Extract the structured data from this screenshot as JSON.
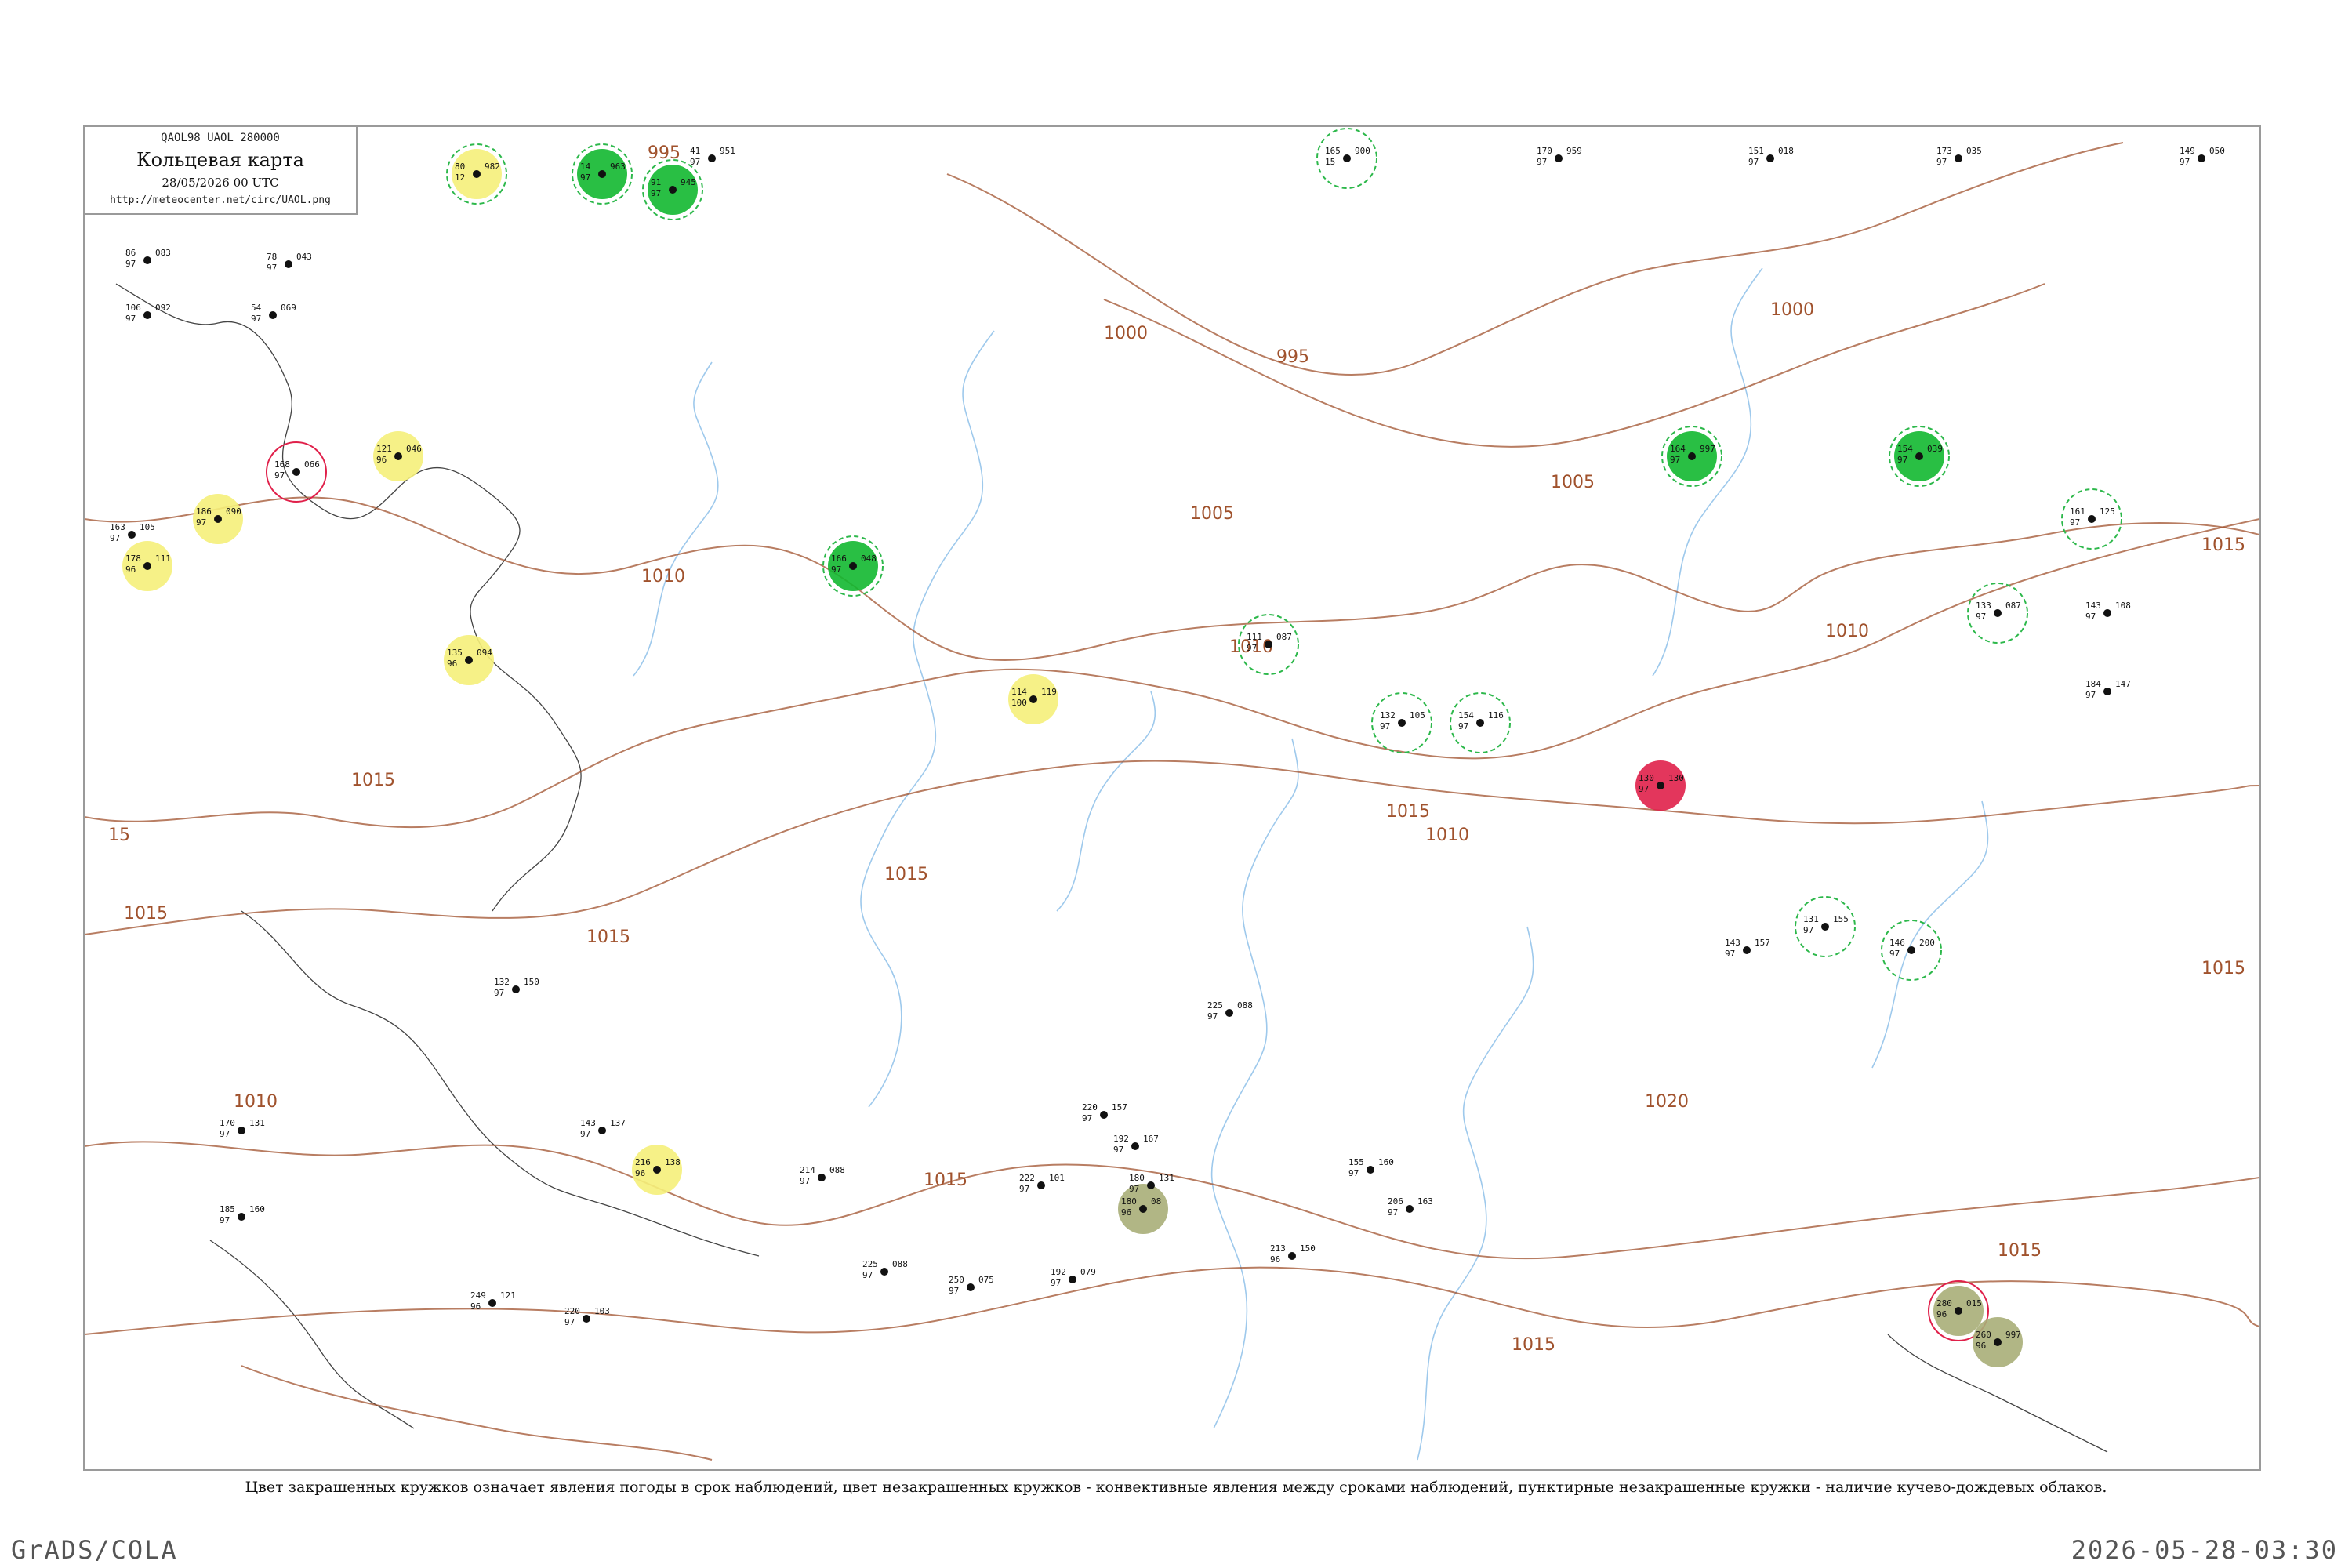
{
  "header": {
    "code": "QAOL98  UAOL  280000",
    "title": "Кольцевая карта",
    "date": "28/05/2026 00 UTC",
    "url": "http://meteocenter.net/circ/UAOL.png"
  },
  "caption": "Цвет закрашенных кружков означает явления погоды в срок наблюдений, цвет незакрашенных кружков - конвективные явления между сроками наблюдений, пунктирные незакрашенные кружки - наличие кучево-дождевых облаков.",
  "footer": {
    "left": "GrADS/COLA",
    "right": "2026-05-28-03:30"
  },
  "colors": {
    "isobar": "#a0522d",
    "river": "#9ec9ec",
    "shower_fill": "#12b830",
    "cb_dashed": "#2db84b",
    "haze_fill": "#f5f07a",
    "thunder_fill": "#e0204a",
    "dust_fill": "#a8ae78"
  },
  "isobar_labels": [
    "995",
    "995",
    "1000",
    "1000",
    "1005",
    "1005",
    "1010",
    "1010",
    "1010",
    "1010",
    "1015",
    "1015",
    "1015",
    "1015",
    "1015",
    "1015",
    "1015",
    "1015",
    "1015",
    "1020",
    "1010",
    "15",
    "1015"
  ],
  "stations": [
    {
      "p": "982",
      "t": "80",
      "td": "12",
      "fill": "haze_fill",
      "ring": "cb_dashed"
    },
    {
      "p": "951",
      "t": "41",
      "td": "97",
      "fill": "",
      "ring": ""
    },
    {
      "p": "963",
      "t": "14",
      "td": "97",
      "fill": "shower_fill",
      "ring": "cb_dashed"
    },
    {
      "p": "945",
      "t": "91",
      "td": "97",
      "fill": "shower_fill",
      "ring": "cb_dashed"
    },
    {
      "p": "900",
      "t": "165",
      "td": "15",
      "fill": "",
      "ring": "cb_dashed"
    },
    {
      "p": "959",
      "t": "170",
      "td": "97",
      "fill": "",
      "ring": ""
    },
    {
      "p": "018",
      "t": "151",
      "td": "97",
      "fill": "",
      "ring": ""
    },
    {
      "p": "035",
      "t": "173",
      "td": "97",
      "fill": "",
      "ring": ""
    },
    {
      "p": "050",
      "t": "149",
      "td": "97",
      "fill": "",
      "ring": ""
    },
    {
      "p": "083",
      "t": "86",
      "td": "97",
      "fill": "",
      "ring": ""
    },
    {
      "p": "043",
      "t": "78",
      "td": "97",
      "fill": "",
      "ring": ""
    },
    {
      "p": "092",
      "t": "106",
      "td": "97",
      "fill": "",
      "ring": ""
    },
    {
      "p": "069",
      "t": "54",
      "td": "97",
      "fill": "",
      "ring": ""
    },
    {
      "p": "066",
      "t": "168",
      "td": "97",
      "fill": "",
      "ring": "thunder_fill"
    },
    {
      "p": "090",
      "t": "186",
      "td": "97",
      "fill": "haze_fill",
      "ring": ""
    },
    {
      "p": "111",
      "t": "178",
      "td": "96",
      "fill": "haze_fill",
      "ring": ""
    },
    {
      "p": "105",
      "t": "163",
      "td": "97",
      "fill": "",
      "ring": ""
    },
    {
      "p": "046",
      "t": "121",
      "td": "96",
      "fill": "haze_fill",
      "ring": ""
    },
    {
      "p": "094",
      "t": "135",
      "td": "96",
      "fill": "haze_fill",
      "ring": ""
    },
    {
      "p": "119",
      "t": "114",
      "td": "100",
      "fill": "haze_fill",
      "ring": ""
    },
    {
      "p": "138",
      "t": "216",
      "td": "96",
      "fill": "haze_fill",
      "ring": ""
    },
    {
      "p": "130",
      "t": "130",
      "td": "97",
      "fill": "thunder_fill",
      "ring": ""
    },
    {
      "p": "015",
      "t": "280",
      "td": "96",
      "fill": "dust_fill",
      "ring": "thunder_fill"
    },
    {
      "p": "997",
      "t": "260",
      "td": "96",
      "fill": "dust_fill",
      "ring": ""
    },
    {
      "p": "08",
      "t": "180",
      "td": "96",
      "fill": "dust_fill",
      "ring": ""
    },
    {
      "p": "997",
      "t": "164",
      "td": "97",
      "fill": "shower_fill",
      "ring": "cb_dashed"
    },
    {
      "p": "039",
      "t": "154",
      "td": "97",
      "fill": "shower_fill",
      "ring": "cb_dashed"
    },
    {
      "p": "048",
      "t": "166",
      "td": "97",
      "fill": "shower_fill",
      "ring": "cb_dashed"
    },
    {
      "p": "087",
      "t": "111",
      "td": "97",
      "fill": "",
      "ring": "cb_dashed"
    },
    {
      "p": "105",
      "t": "132",
      "td": "97",
      "fill": "",
      "ring": "cb_dashed"
    },
    {
      "p": "116",
      "t": "154",
      "td": "97",
      "fill": "",
      "ring": "cb_dashed"
    },
    {
      "p": "147",
      "t": "184",
      "td": "97",
      "fill": "",
      "ring": ""
    },
    {
      "p": "125",
      "t": "161",
      "td": "97",
      "fill": "",
      "ring": "cb_dashed"
    },
    {
      "p": "087",
      "t": "133",
      "td": "97",
      "fill": "",
      "ring": "cb_dashed"
    },
    {
      "p": "108",
      "t": "143",
      "td": "97",
      "fill": "",
      "ring": ""
    },
    {
      "p": "155",
      "t": "131",
      "td": "97",
      "fill": "",
      "ring": "cb_dashed"
    },
    {
      "p": "200",
      "t": "146",
      "td": "97",
      "fill": "",
      "ring": "cb_dashed"
    },
    {
      "p": "157",
      "t": "143",
      "td": "97",
      "fill": "",
      "ring": ""
    },
    {
      "p": "088",
      "t": "225",
      "td": "97",
      "fill": "",
      "ring": ""
    },
    {
      "p": "075",
      "t": "250",
      "td": "97",
      "fill": "",
      "ring": ""
    },
    {
      "p": "163",
      "t": "206",
      "td": "97",
      "fill": "",
      "ring": ""
    },
    {
      "p": "150",
      "t": "213",
      "td": "96",
      "fill": "",
      "ring": ""
    },
    {
      "p": "101",
      "t": "222",
      "td": "97",
      "fill": "",
      "ring": ""
    },
    {
      "p": "131",
      "t": "180",
      "td": "97",
      "fill": "",
      "ring": ""
    },
    {
      "p": "088",
      "t": "214",
      "td": "97",
      "fill": "",
      "ring": ""
    },
    {
      "p": "121",
      "t": "249",
      "td": "96",
      "fill": "",
      "ring": ""
    },
    {
      "p": "103",
      "t": "220",
      "td": "97",
      "fill": "",
      "ring": ""
    },
    {
      "p": "160",
      "t": "185",
      "td": "97",
      "fill": "",
      "ring": ""
    },
    {
      "p": "131",
      "t": "170",
      "td": "97",
      "fill": "",
      "ring": ""
    },
    {
      "p": "137",
      "t": "143",
      "td": "97",
      "fill": "",
      "ring": ""
    },
    {
      "p": "150",
      "t": "132",
      "td": "97",
      "fill": "",
      "ring": ""
    },
    {
      "p": "079",
      "t": "192",
      "td": "97",
      "fill": "",
      "ring": ""
    },
    {
      "p": "167",
      "t": "192",
      "td": "97",
      "fill": "",
      "ring": ""
    },
    {
      "p": "157",
      "t": "220",
      "td": "97",
      "fill": "",
      "ring": ""
    },
    {
      "p": "160",
      "t": "155",
      "td": "97",
      "fill": "",
      "ring": ""
    },
    {
      "p": "088",
      "t": "225",
      "td": "97",
      "fill": "",
      "ring": ""
    }
  ]
}
